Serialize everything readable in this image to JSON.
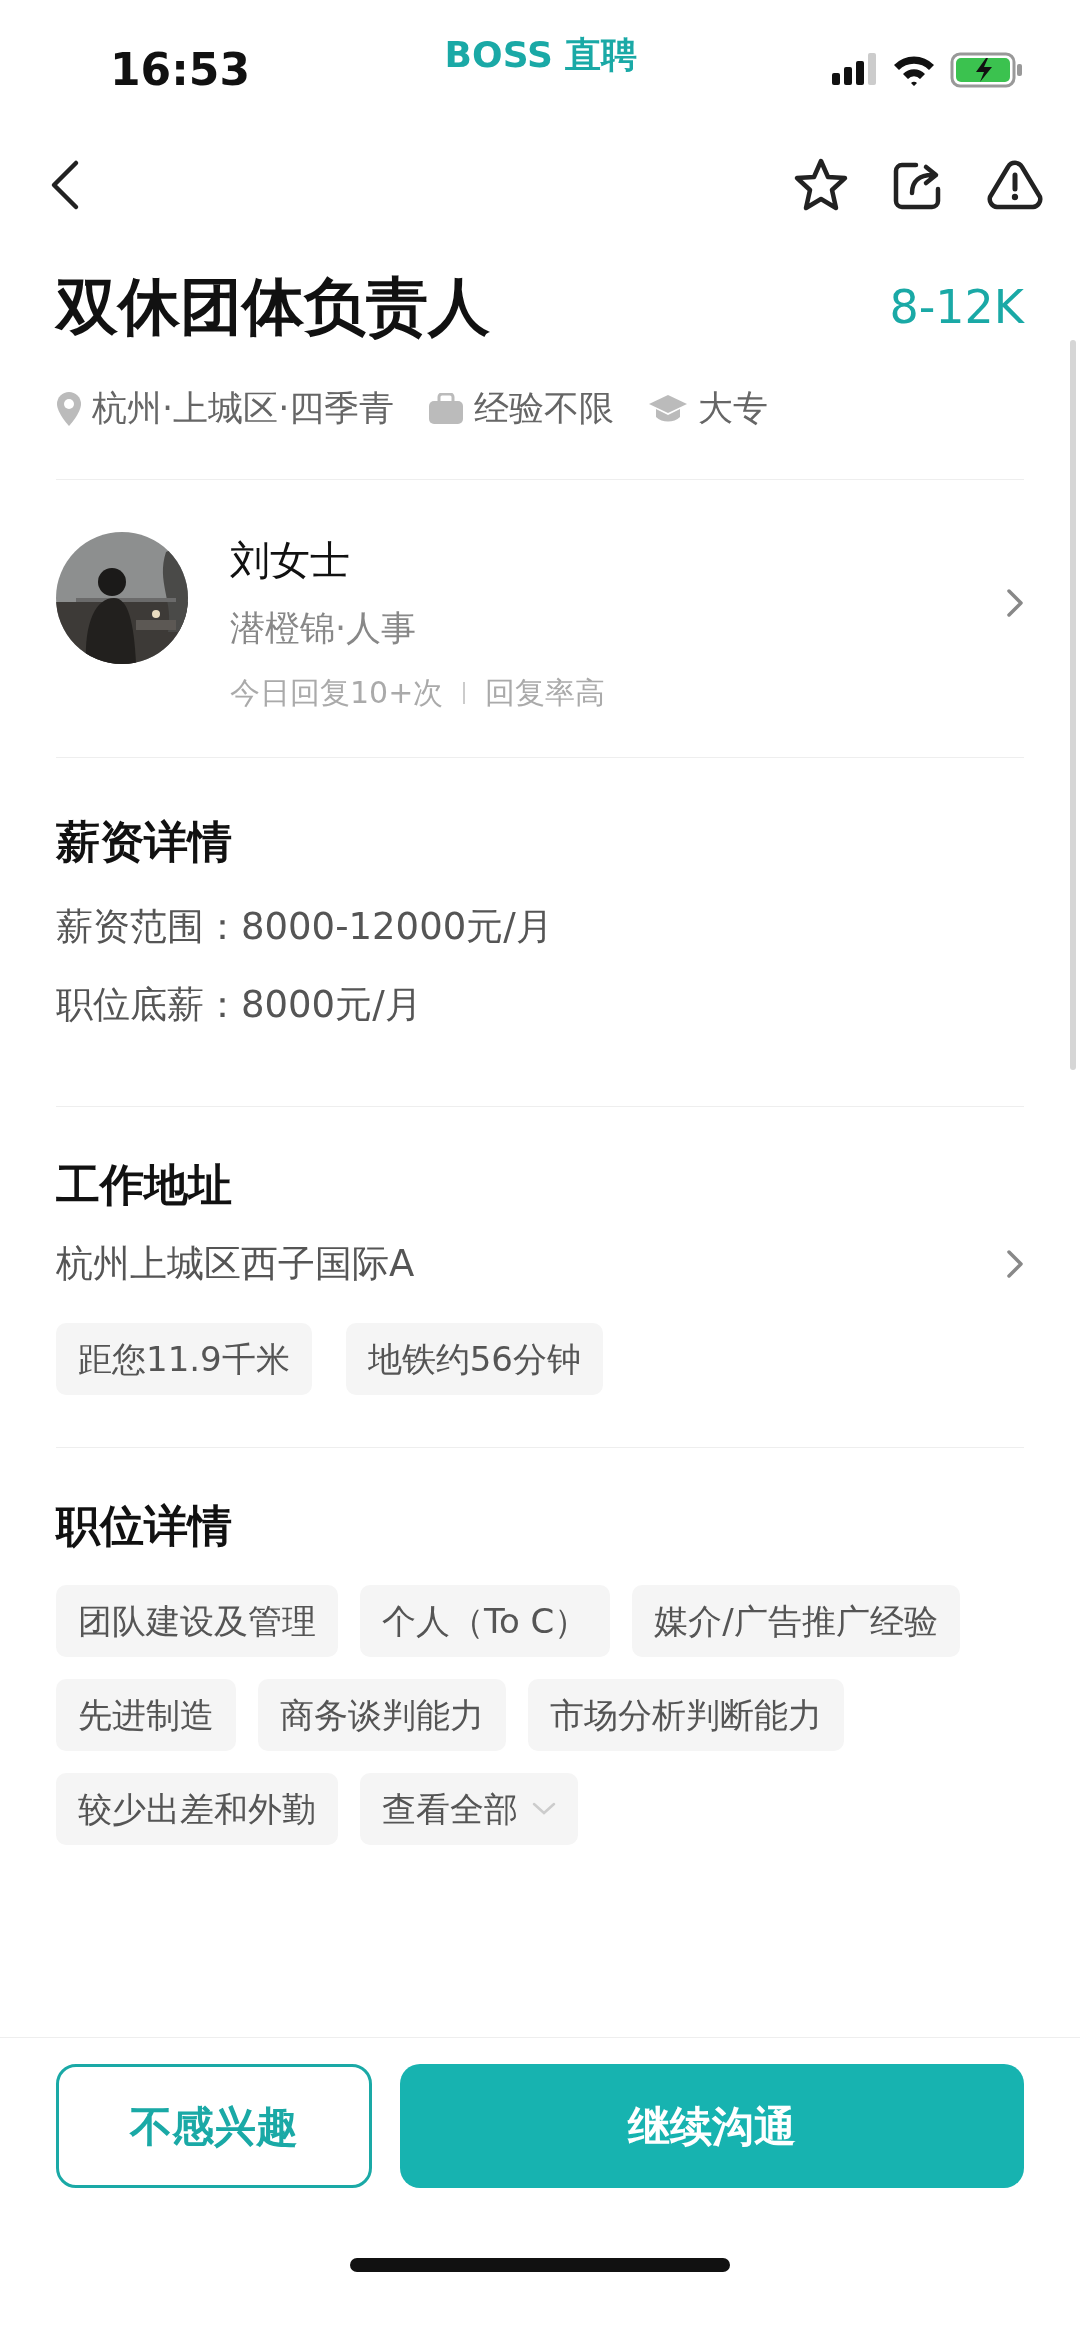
{
  "status_bar": {
    "time": "16:53",
    "app": "BOSS 直聘"
  },
  "job": {
    "title": "双休团体负责人",
    "salary": "8-12K",
    "meta": [
      {
        "kind": "location",
        "text": "杭州·上城区·四季青"
      },
      {
        "kind": "experience",
        "text": "经验不限"
      },
      {
        "kind": "education",
        "text": "大专"
      }
    ]
  },
  "recruiter": {
    "name": "刘女士",
    "company": "潜橙锦·人事",
    "activity": "今日回复10+次",
    "rate": "回复率高"
  },
  "salary_section": {
    "heading": "薪资详情",
    "lines": [
      "薪资范围：8000-12000元/月",
      "职位底薪：8000元/月"
    ]
  },
  "address_section": {
    "heading": "工作地址",
    "address": "杭州上城区西子国际A",
    "chips": [
      "距您11.9千米",
      "地铁约56分钟"
    ]
  },
  "job_section": {
    "heading": "职位详情",
    "tags": [
      {
        "kind": "tag",
        "text": "团队建设及管理"
      },
      {
        "kind": "tag",
        "text": "个人（To C）"
      },
      {
        "kind": "tag",
        "text": "媒介/广告推广经验"
      },
      {
        "kind": "tag",
        "text": "先进制造"
      },
      {
        "kind": "tag",
        "text": "商务谈判能力"
      },
      {
        "kind": "tag",
        "text": "市场分析判断能力"
      },
      {
        "kind": "tag",
        "text": "较少出差和外勤"
      },
      {
        "kind": "more",
        "text": "查看全部"
      }
    ]
  },
  "actions": [
    {
      "kind": "outline",
      "label": "不感兴趣"
    },
    {
      "kind": "primary",
      "label": "继续沟通"
    }
  ]
}
